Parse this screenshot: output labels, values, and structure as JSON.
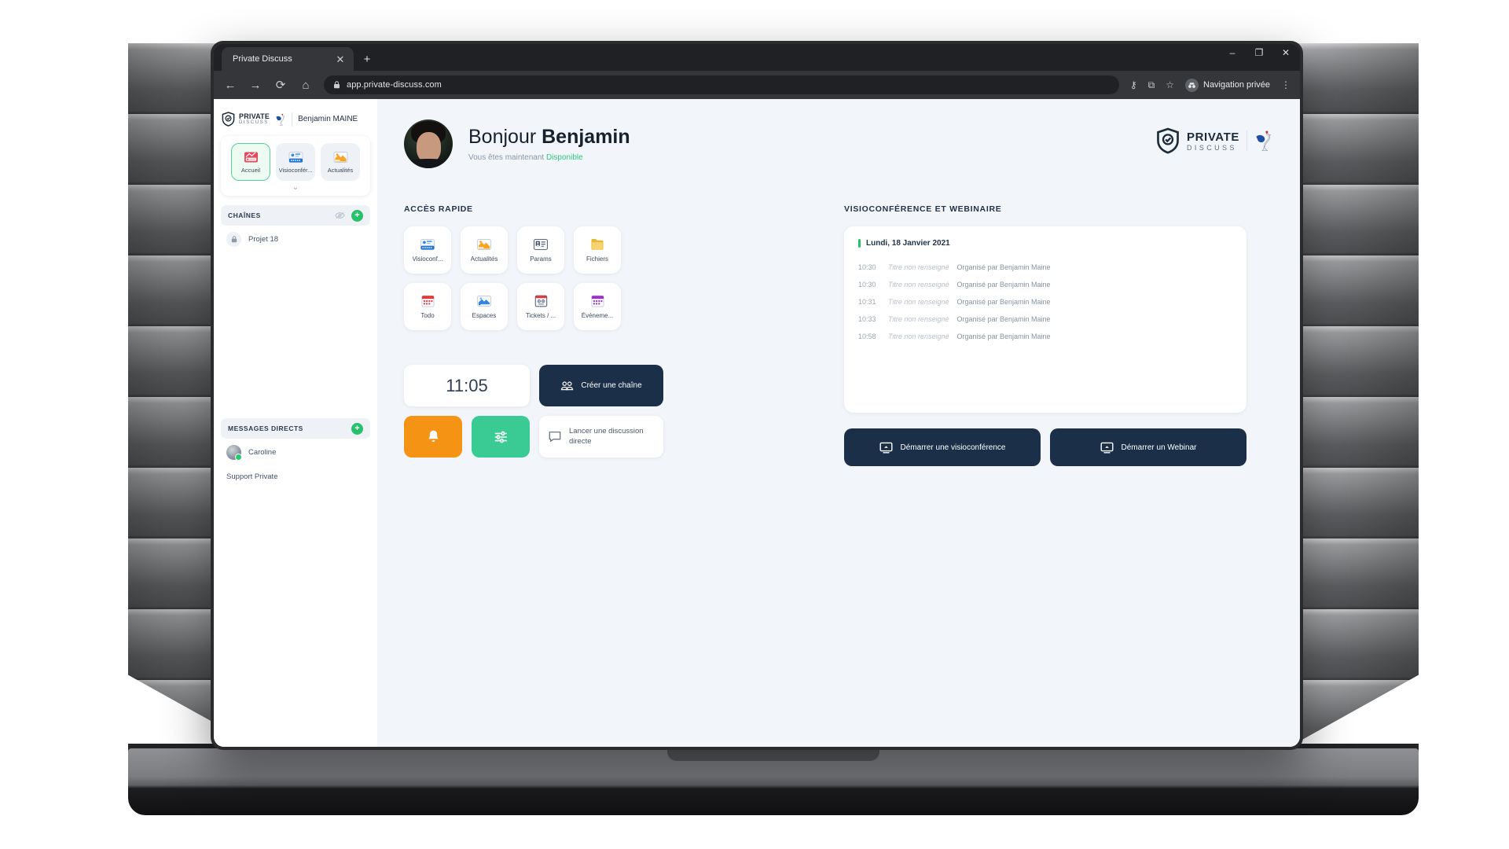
{
  "browser": {
    "tab_title": "Private Discuss",
    "close_label": "✕",
    "new_tab_label": "+",
    "back_icon": "←",
    "forward_icon": "→",
    "reload_icon": "⟳",
    "home_icon": "⌂",
    "lock_icon": "🔒",
    "url": "app.private-discuss.com",
    "key_icon": "⚷",
    "extension_icon": "⧉",
    "star_icon": "☆",
    "incognito_label": "Navigation privée",
    "incognito_glyph": "●●",
    "menu_icon": "⋮",
    "window_minimize": "–",
    "window_maximize": "❐",
    "window_close": "✕"
  },
  "brand": {
    "line1": "PRIVATE",
    "line2": "DISCUSS"
  },
  "sidebar": {
    "user_name": "Benjamin MAINE",
    "nav_items": [
      {
        "label": "Accueil",
        "icon": "home-presentation-icon",
        "active": true
      },
      {
        "label": "Visioconfér...",
        "icon": "video-card-icon",
        "active": false
      },
      {
        "label": "Actualités",
        "icon": "news-icon",
        "active": false
      }
    ],
    "expand_icon": "⌄",
    "channels": {
      "title": "CHAÎNES",
      "hide_icon": "◎",
      "add_icon": "+",
      "items": [
        {
          "label": "Projet 18",
          "icon": "lock-icon"
        }
      ]
    },
    "direct_messages": {
      "title": "MESSAGES DIRECTS",
      "add_icon": "+",
      "items": [
        {
          "label": "Caroline",
          "has_avatar": true
        },
        {
          "label": "Support Private",
          "has_avatar": false
        }
      ]
    }
  },
  "main": {
    "greeting_prefix": "Bonjour ",
    "greeting_name": "Benjamin",
    "status_prefix": "Vous êtes maintenant ",
    "status_value": "Disponible",
    "quick_access": {
      "title": "ACCÈS RAPIDE",
      "tiles": [
        {
          "label": "Visioconf...",
          "icon": "video-card-icon"
        },
        {
          "label": "Actualités",
          "icon": "news-icon"
        },
        {
          "label": "Params",
          "icon": "settings-card-icon"
        },
        {
          "label": "Fichiers",
          "icon": "folder-icon"
        },
        {
          "label": "Todo",
          "icon": "calendar-red-icon"
        },
        {
          "label": "Espaces",
          "icon": "spaces-icon"
        },
        {
          "label": "Tickets / ...",
          "icon": "tickets-icon"
        },
        {
          "label": "Événeme...",
          "icon": "calendar-purple-icon"
        }
      ]
    },
    "actions": {
      "clock": "11:05",
      "create_channel": "Créer une chaîne",
      "notifications_icon": "bell-icon",
      "settings_icon": "sliders-icon",
      "direct_discussion": "Lancer une discussion directe"
    },
    "meetings": {
      "title": "VISIOCONFÉRENCE ET WEBINAIRE",
      "date": "Lundi, 18 Janvier 2021",
      "rows": [
        {
          "time": "10:30",
          "subject": "Titre non renseigné",
          "organizer": "Organisé par Benjamin Maine"
        },
        {
          "time": "10:30",
          "subject": "Titre non renseigné",
          "organizer": "Organisé par Benjamin Maine"
        },
        {
          "time": "10:31",
          "subject": "Titre non renseigné",
          "organizer": "Organisé par Benjamin Maine"
        },
        {
          "time": "10:33",
          "subject": "Titre non renseigné",
          "organizer": "Organisé par Benjamin Maine"
        },
        {
          "time": "10:58",
          "subject": "Titre non renseigné",
          "organizer": "Organisé par Benjamin Maine"
        }
      ],
      "start_video": "Démarrer une visioconférence",
      "start_webinar": "Démarrer un Webinar"
    }
  },
  "colors": {
    "accent_green": "#27c16c",
    "navy": "#1b2f48",
    "orange": "#f59314",
    "mint": "#39cb93",
    "page_bg": "#f2f5f9"
  }
}
